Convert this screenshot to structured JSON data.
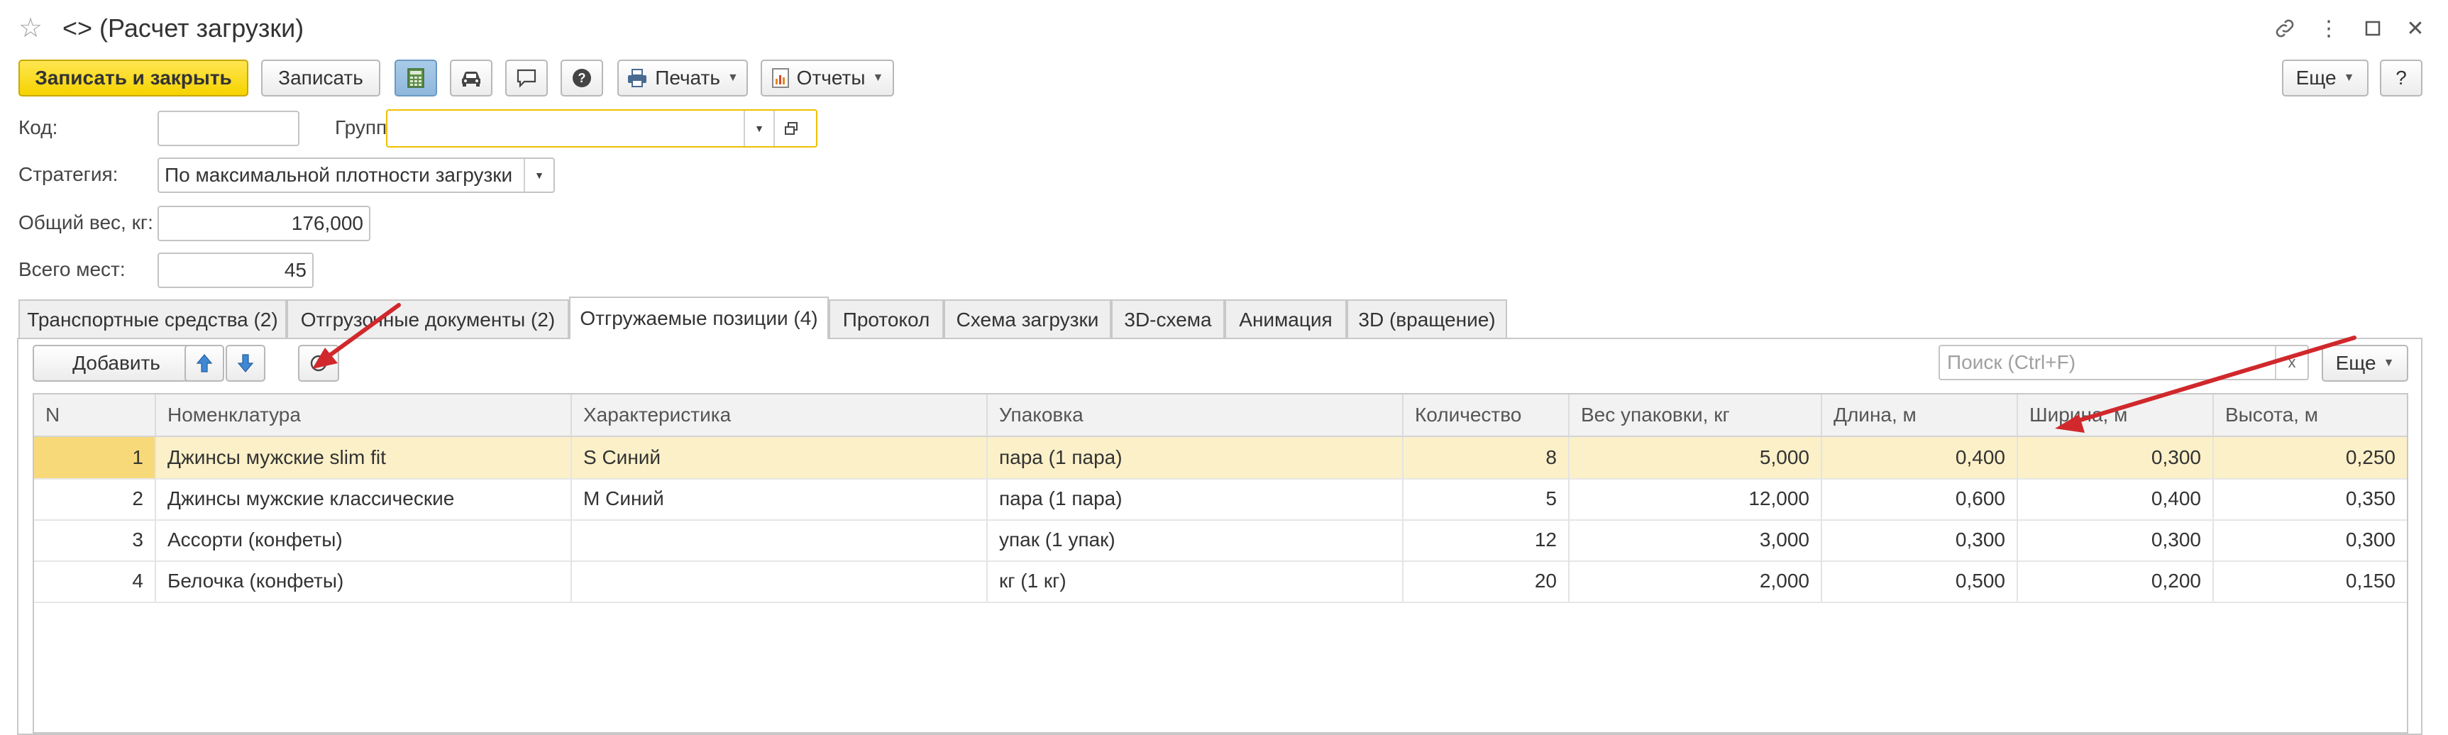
{
  "window": {
    "title": "<> (Расчет загрузки)"
  },
  "toolbar": {
    "save_close_label": "Записать и закрыть",
    "save_label": "Записать",
    "print_label": "Печать",
    "reports_label": "Отчеты",
    "more_label": "Еще",
    "help_label": "?"
  },
  "form": {
    "code_label": "Код:",
    "code_value": "",
    "group_label": "Группа:",
    "group_value": "",
    "strategy_label": "Стратегия:",
    "strategy_value": "По максимальной плотности загрузки",
    "weight_label": "Общий вес, кг:",
    "weight_value": "176,000",
    "places_label": "Всего мест:",
    "places_value": "45"
  },
  "tabs": [
    {
      "label": "Транспортные средства (2)"
    },
    {
      "label": "Отгрузочные документы (2)"
    },
    {
      "label": "Отгружаемые позиции (4)",
      "active": true
    },
    {
      "label": "Протокол"
    },
    {
      "label": "Схема загрузки"
    },
    {
      "label": "3D-схема"
    },
    {
      "label": "Анимация"
    },
    {
      "label": "3D (вращение)"
    }
  ],
  "panel_toolbar": {
    "add_label": "Добавить",
    "search_placeholder": "Поиск (Ctrl+F)",
    "clear_label": "x",
    "more_label": "Еще"
  },
  "table": {
    "columns": [
      "N",
      "Номенклатура",
      "Характеристика",
      "Упаковка",
      "Количество",
      "Вес упаковки, кг",
      "Длина, м",
      "Ширина, м",
      "Высота, м"
    ],
    "rows": [
      [
        "1",
        "Джинсы мужские slim fit",
        "S Синий",
        "пара (1 пара)",
        "8",
        "5,000",
        "0,400",
        "0,300",
        "0,250"
      ],
      [
        "2",
        "Джинсы мужские классические",
        "M Синий",
        "пара (1 пара)",
        "5",
        "12,000",
        "0,600",
        "0,400",
        "0,350"
      ],
      [
        "3",
        "Ассорти (конфеты)",
        "",
        "упак (1 упак)",
        "12",
        "3,000",
        "0,300",
        "0,300",
        "0,300"
      ],
      [
        "4",
        "Белочка (конфеты)",
        "",
        "кг (1 кг)",
        "20",
        "2,000",
        "0,500",
        "0,200",
        "0,150"
      ]
    ],
    "selected_row": 0
  },
  "colors": {
    "primary_button": "#f5d300",
    "selected_row": "#fbf0c8",
    "annotation_arrow": "#d0282c"
  }
}
